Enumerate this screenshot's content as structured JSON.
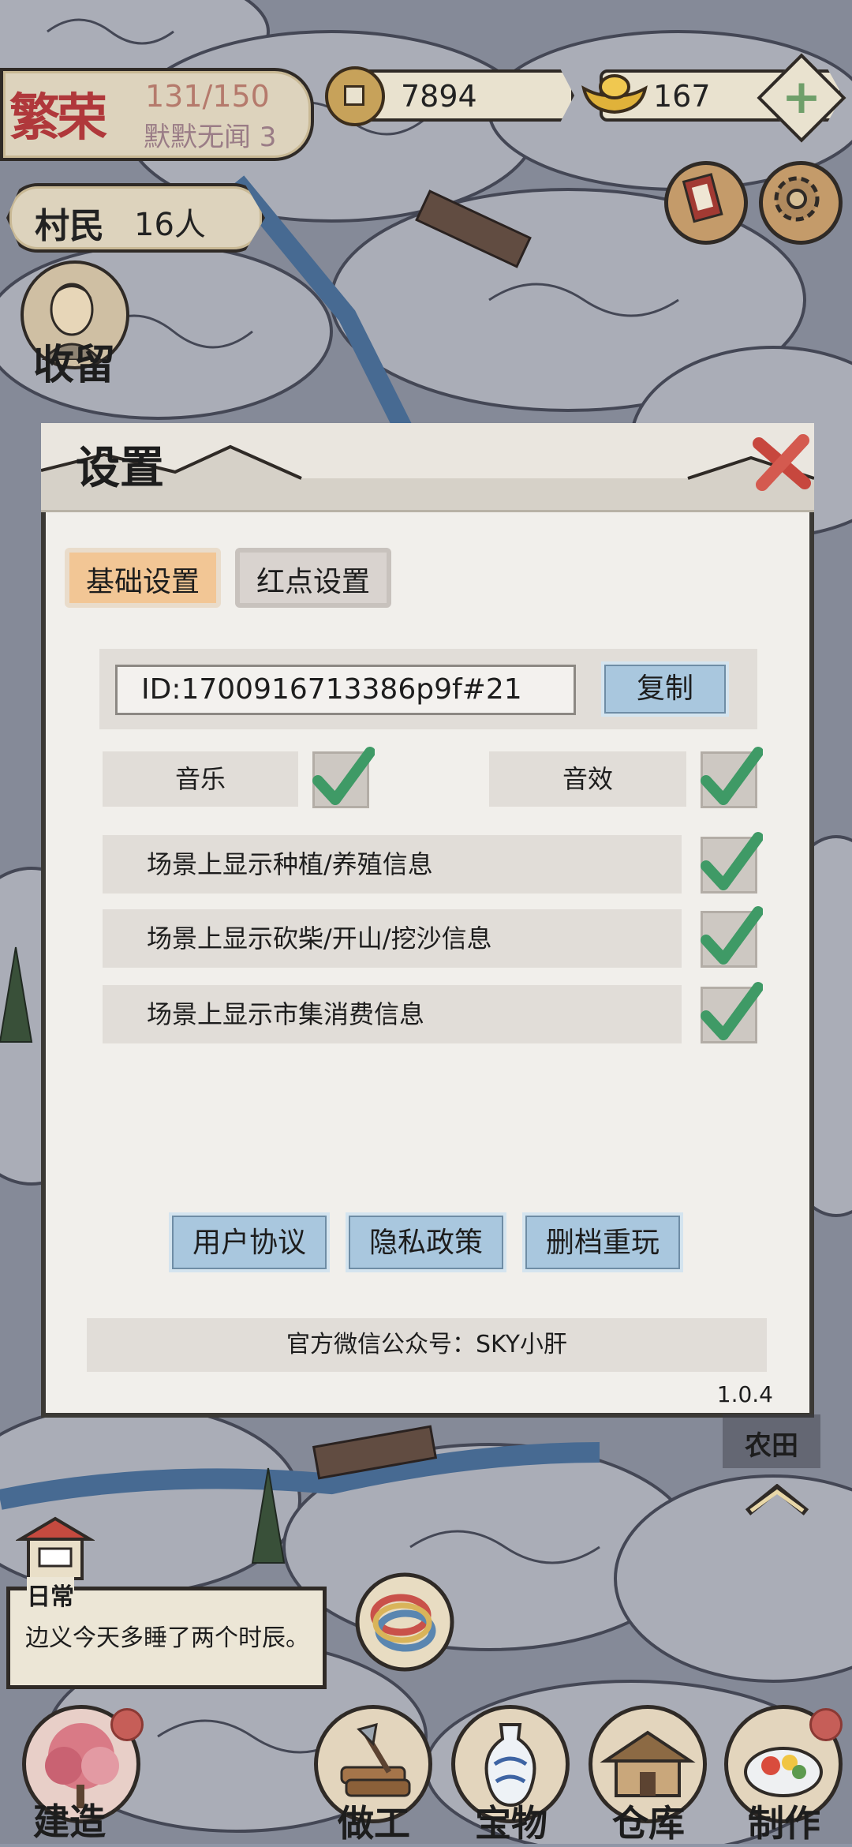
{
  "hud": {
    "prosperity_label": "繁荣",
    "prosperity_score": "131/150",
    "village_name": "默默无闻 3",
    "copper_coins": "7894",
    "gold_ingots": "167",
    "plus": "+",
    "villagers_label": "村民",
    "villagers_count": "16人",
    "shelter_label": "收留"
  },
  "dialog": {
    "title": "设置",
    "tabs": [
      {
        "label": "基础设置",
        "active": true
      },
      {
        "label": "红点设置",
        "active": false
      }
    ],
    "id_value": "ID:1700916713386p9f#21",
    "copy_label": "复制",
    "music_label": "音乐",
    "music_checked": true,
    "sfx_label": "音效",
    "sfx_checked": true,
    "options": [
      {
        "label": "场景上显示种植/养殖信息",
        "checked": true
      },
      {
        "label": "场景上显示砍柴/开山/挖沙信息",
        "checked": true
      },
      {
        "label": "场景上显示市集消费信息",
        "checked": true
      }
    ],
    "buttons": {
      "user_agreement": "用户协议",
      "privacy_policy": "隐私政策",
      "delete_restart": "删档重玩"
    },
    "wechat": "官方微信公众号：SKY小肝",
    "version": "1.0.4"
  },
  "map": {
    "farm_label": "农田"
  },
  "daily": {
    "title": "日常",
    "message": "边义今天多睡了两个时辰。"
  },
  "nav": {
    "build": "建造",
    "work": "做工",
    "treasure": "宝物",
    "warehouse": "仓库",
    "craft": "制作"
  },
  "colors": {
    "tab_active": "#f2c695",
    "button_blue": "#a9c7de",
    "check_green": "#3f9a66",
    "panel": "#f1efeb"
  }
}
